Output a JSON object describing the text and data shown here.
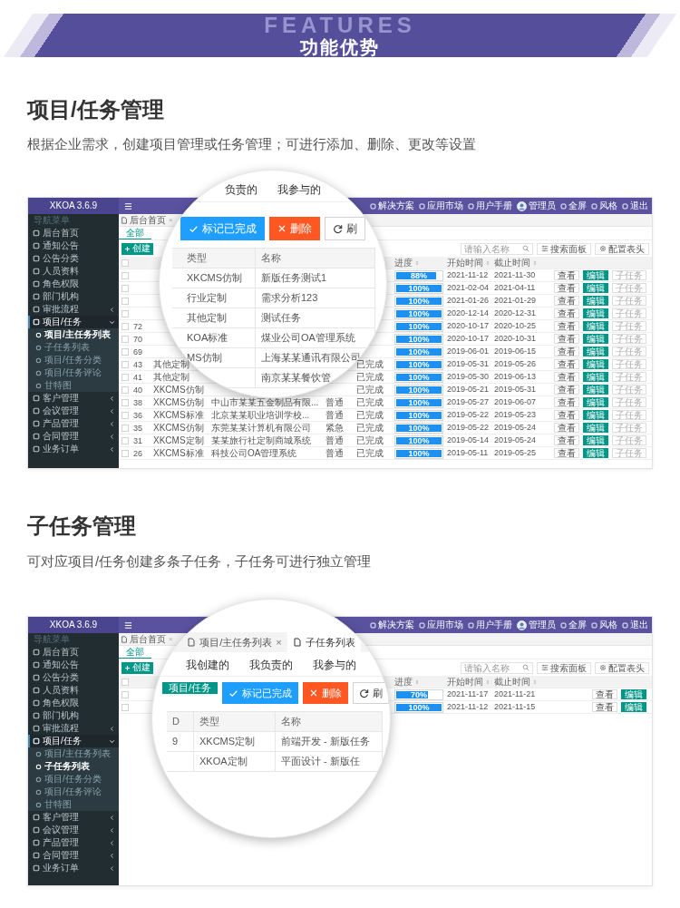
{
  "banner": {
    "backdrop_text": "FEATURES",
    "title": "功能优势"
  },
  "sections": [
    {
      "heading": "项目/任务管理",
      "description": "根据企业需求，创建项目管理或任务管理；可进行添加、删除、更改等设置",
      "screenshot": {
        "top_bar": {
          "logo": "XKOA 3.6.9",
          "items": [
            {
              "kind": "link",
              "label": "解决方案"
            },
            {
              "kind": "link",
              "label": "应用市场"
            },
            {
              "kind": "link",
              "label": "用户手册"
            },
            {
              "kind": "user",
              "label": "管理员"
            },
            {
              "kind": "link",
              "label": "全屏"
            },
            {
              "kind": "link",
              "label": "风格"
            },
            {
              "kind": "link",
              "label": "退出"
            }
          ]
        },
        "sidebar": {
          "header": "导航菜单",
          "items": [
            {
              "kind": "link",
              "label": "后台首页"
            },
            {
              "kind": "link",
              "label": "通知公告"
            },
            {
              "kind": "link",
              "label": "公告分类"
            },
            {
              "kind": "link",
              "label": "人员资料"
            },
            {
              "kind": "link",
              "label": "角色权限"
            },
            {
              "kind": "link",
              "label": "部门机构"
            },
            {
              "kind": "group",
              "label": "审批流程",
              "expanded": false
            },
            {
              "kind": "group",
              "label": "项目/任务",
              "expanded": true,
              "children": [
                {
                  "label": "项目/主任务列表",
                  "selected": true
                },
                {
                  "label": "子任务列表",
                  "selected": false
                },
                {
                  "label": "项目/任务分类",
                  "selected": false
                },
                {
                  "label": "项目/任务评论",
                  "selected": false
                },
                {
                  "label": "甘特图",
                  "selected": false
                }
              ]
            },
            {
              "kind": "group",
              "label": "客户管理",
              "expanded": false
            },
            {
              "kind": "group",
              "label": "会议管理",
              "expanded": false
            },
            {
              "kind": "group",
              "label": "产品管理",
              "expanded": false
            },
            {
              "kind": "group",
              "label": "合同管理",
              "expanded": false
            },
            {
              "kind": "group",
              "label": "业务订单",
              "expanded": false
            }
          ]
        },
        "page_tabs": [
          {
            "label": "后台首页",
            "close": "×"
          }
        ],
        "filter_tabs": [
          {
            "label": "全部",
            "selected": true
          }
        ],
        "create_button": {
          "label": "创建"
        },
        "search": {
          "placeholder": "请输入名称"
        },
        "tool_buttons": [
          {
            "kind": "panel",
            "label": "搜索面板"
          },
          {
            "kind": "settings",
            "label": "配置表头"
          }
        ],
        "table": {
          "all_checked": false,
          "headers": {
            "progress": "进度",
            "start": "开始时间",
            "end": "截止时间"
          },
          "rows": [
            {
              "checked": false,
              "progress": {
                "level": 0.88,
                "label": "88%"
              },
              "start": "2021-11-12",
              "end": "2021-11-30",
              "actions": [
                {
                  "kind": "view",
                  "label": "查看"
                },
                {
                  "kind": "edit",
                  "label": "编辑"
                },
                {
                  "kind": "subtask",
                  "label": "子任务"
                }
              ]
            },
            {
              "checked": false,
              "progress": {
                "level": 1,
                "label": "100%"
              },
              "start": "2021-02-04",
              "end": "2021-04-11",
              "actions": [
                {
                  "kind": "view",
                  "label": "查看"
                },
                {
                  "kind": "edit",
                  "label": "编辑"
                },
                {
                  "kind": "subtask",
                  "label": "子任务"
                }
              ]
            },
            {
              "checked": false,
              "progress": {
                "level": 1,
                "label": "100%"
              },
              "start": "2021-01-26",
              "end": "2021-01-29",
              "actions": [
                {
                  "kind": "view",
                  "label": "查看"
                },
                {
                  "kind": "edit",
                  "label": "编辑"
                },
                {
                  "kind": "subtask",
                  "label": "子任务"
                }
              ]
            },
            {
              "checked": false,
              "progress": {
                "level": 1,
                "label": "100%"
              },
              "start": "2020-12-14",
              "end": "2020-12-31",
              "actions": [
                {
                  "kind": "view",
                  "label": "查看"
                },
                {
                  "kind": "edit",
                  "label": "编辑"
                },
                {
                  "kind": "subtask",
                  "label": "子任务"
                }
              ]
            },
            {
              "checked": false,
              "id": "72",
              "progress": {
                "level": 1,
                "label": "100%"
              },
              "start": "2020-10-17",
              "end": "2020-10-25",
              "actions": [
                {
                  "kind": "view",
                  "label": "查看"
                },
                {
                  "kind": "edit",
                  "label": "编辑"
                },
                {
                  "kind": "subtask",
                  "label": "子任务"
                }
              ]
            },
            {
              "checked": false,
              "id": "70",
              "progress": {
                "level": 1,
                "label": "100%"
              },
              "start": "2020-10-17",
              "end": "2020-10-31",
              "actions": [
                {
                  "kind": "view",
                  "label": "查看"
                },
                {
                  "kind": "edit",
                  "label": "编辑"
                },
                {
                  "kind": "subtask",
                  "label": "子任务"
                }
              ]
            },
            {
              "checked": false,
              "id": "69",
              "progress": {
                "level": 1,
                "label": "100%"
              },
              "start": "2019-06-01",
              "end": "2019-06-15",
              "actions": [
                {
                  "kind": "view",
                  "label": "查看"
                },
                {
                  "kind": "edit",
                  "label": "编辑"
                },
                {
                  "kind": "subtask",
                  "label": "子任务"
                }
              ]
            },
            {
              "checked": false,
              "id": "43",
              "type": "其他定制",
              "status": "已完成",
              "progress": {
                "level": 1,
                "label": "100%"
              },
              "start": "2019-05-31",
              "end": "2019-05-26",
              "actions": [
                {
                  "kind": "view",
                  "label": "查看"
                },
                {
                  "kind": "edit",
                  "label": "编辑"
                },
                {
                  "kind": "subtask",
                  "label": "子任务"
                }
              ]
            },
            {
              "checked": false,
              "id": "41",
              "type": "其他定制",
              "status": "已完成",
              "progress": {
                "level": 1,
                "label": "100%"
              },
              "start": "2019-05-30",
              "end": "2019-06-13",
              "actions": [
                {
                  "kind": "view",
                  "label": "查看"
                },
                {
                  "kind": "edit",
                  "label": "编辑"
                },
                {
                  "kind": "subtask",
                  "label": "子任务"
                }
              ]
            },
            {
              "checked": false,
              "id": "40",
              "type": "XKCMS仿制",
              "status": "已完成",
              "progress": {
                "level": 1,
                "label": "100%"
              },
              "start": "2019-05-21",
              "end": "2019-05-31",
              "actions": [
                {
                  "kind": "view",
                  "label": "查看"
                },
                {
                  "kind": "edit",
                  "label": "编辑"
                },
                {
                  "kind": "subtask",
                  "label": "子任务"
                }
              ]
            },
            {
              "checked": false,
              "id": "38",
              "type": "XKCMS仿制",
              "name": "中山市某某五金制品有限...",
              "level": "普通",
              "status": "已完成",
              "progress": {
                "level": 1,
                "label": "100%"
              },
              "start": "2019-05-27",
              "end": "2019-06-07",
              "actions": [
                {
                  "kind": "view",
                  "label": "查看"
                },
                {
                  "kind": "edit",
                  "label": "编辑"
                },
                {
                  "kind": "subtask",
                  "label": "子任务"
                }
              ]
            },
            {
              "checked": false,
              "id": "36",
              "type": "XKCMS标准",
              "name": "北京某某职业培训学校...",
              "level": "普通",
              "status": "已完成",
              "progress": {
                "level": 1,
                "label": "100%"
              },
              "start": "2019-05-22",
              "end": "2019-05-23",
              "actions": [
                {
                  "kind": "view",
                  "label": "查看"
                },
                {
                  "kind": "edit",
                  "label": "编辑"
                },
                {
                  "kind": "subtask",
                  "label": "子任务"
                }
              ]
            },
            {
              "checked": false,
              "id": "35",
              "type": "XKCMS仿制",
              "name": "东莞某某计算机有限公司",
              "level": "紧急",
              "status": "已完成",
              "progress": {
                "level": 1,
                "label": "100%"
              },
              "start": "2019-05-22",
              "end": "2019-05-24",
              "actions": [
                {
                  "kind": "view",
                  "label": "查看"
                },
                {
                  "kind": "edit",
                  "label": "编辑"
                },
                {
                  "kind": "subtask",
                  "label": "子任务"
                }
              ]
            },
            {
              "checked": false,
              "id": "31",
              "type": "XKCMS定制",
              "name": "某某旅行社定制商城系统",
              "level": "普通",
              "status": "已完成",
              "progress": {
                "level": 1,
                "label": "100%"
              },
              "start": "2019-05-14",
              "end": "2019-05-24",
              "actions": [
                {
                  "kind": "view",
                  "label": "查看"
                },
                {
                  "kind": "edit",
                  "label": "编辑"
                },
                {
                  "kind": "subtask",
                  "label": "子任务"
                }
              ]
            },
            {
              "checked": false,
              "id": "26",
              "type": "XKCMS标准",
              "name": "科技公司OA管理系统",
              "level": "普通",
              "status": "已完成",
              "progress": {
                "level": 1,
                "label": "100%"
              },
              "start": "2019-05-11",
              "end": "2019-05-25",
              "actions": [
                {
                  "kind": "view",
                  "label": "查看"
                },
                {
                  "kind": "edit",
                  "label": "编辑"
                },
                {
                  "kind": "subtask",
                  "label": "子任务"
                }
              ]
            }
          ]
        },
        "magnifier": {
          "tabs": [
            {
              "label": "负责的",
              "selected": false
            },
            {
              "label": "我参与的",
              "selected": false
            }
          ],
          "buttons": [
            {
              "kind": "complete",
              "label": "标记已完成"
            },
            {
              "kind": "delete",
              "label": "删除"
            },
            {
              "kind": "refresh",
              "label": "刷"
            }
          ],
          "columns": [
            {
              "kind": "type",
              "label": "类型"
            },
            {
              "kind": "name",
              "label": "名称"
            }
          ],
          "rows": [
            {
              "type": "XKCMS仿制",
              "name": "新版任务测试1"
            },
            {
              "type": "行业定制",
              "name": "需求分析123"
            },
            {
              "type": "其他定制",
              "name": "测试任务"
            },
            {
              "type": "KOA标准",
              "name": "煤业公司OA管理系统"
            },
            {
              "type": "MS仿制",
              "name": "上海某某通讯有限公司"
            },
            {
              "name": "南京某某餐饮管"
            }
          ]
        }
      }
    },
    {
      "heading": "子任务管理",
      "description": "可对应项目/任务创建多条子任务，子任务可进行独立管理",
      "screenshot": {
        "top_bar": {
          "logo": "XKOA 3.6.9",
          "items": [
            {
              "kind": "link",
              "label": "解决方案"
            },
            {
              "kind": "link",
              "label": "应用市场"
            },
            {
              "kind": "link",
              "label": "用户手册"
            },
            {
              "kind": "user",
              "label": "管理员"
            },
            {
              "kind": "link",
              "label": "全屏"
            },
            {
              "kind": "link",
              "label": "风格"
            },
            {
              "kind": "link",
              "label": "退出"
            }
          ]
        },
        "sidebar": {
          "header": "导航菜单",
          "items": [
            {
              "kind": "link",
              "label": "后台首页"
            },
            {
              "kind": "link",
              "label": "通知公告"
            },
            {
              "kind": "link",
              "label": "公告分类"
            },
            {
              "kind": "link",
              "label": "人员资料"
            },
            {
              "kind": "link",
              "label": "角色权限"
            },
            {
              "kind": "link",
              "label": "部门机构"
            },
            {
              "kind": "group",
              "label": "审批流程",
              "expanded": false
            },
            {
              "kind": "group",
              "label": "项目/任务",
              "expanded": true,
              "children": [
                {
                  "label": "项目/主任务列表",
                  "selected": false
                },
                {
                  "label": "子任务列表",
                  "selected": true
                },
                {
                  "label": "项目/任务分类",
                  "selected": false
                },
                {
                  "label": "项目/任务评论",
                  "selected": false
                },
                {
                  "label": "甘特图",
                  "selected": false
                }
              ]
            },
            {
              "kind": "group",
              "label": "客户管理",
              "expanded": false
            },
            {
              "kind": "group",
              "label": "会议管理",
              "expanded": false
            },
            {
              "kind": "group",
              "label": "产品管理",
              "expanded": false
            },
            {
              "kind": "group",
              "label": "合同管理",
              "expanded": false
            },
            {
              "kind": "group",
              "label": "业务订单",
              "expanded": false
            }
          ]
        },
        "page_tabs": [
          {
            "label": "后台首页",
            "close": "×"
          }
        ],
        "filter_tabs": [
          {
            "label": "全部",
            "selected": true
          }
        ],
        "create_button": {
          "label": "创建"
        },
        "search": {
          "placeholder": "请输入名称"
        },
        "tool_buttons": [
          {
            "kind": "panel",
            "label": "搜索面板"
          },
          {
            "kind": "settings",
            "label": "配置表头"
          }
        ],
        "table": {
          "all_checked": false,
          "headers": {
            "progress": "进度",
            "start": "开始时间",
            "end": "截止时间"
          },
          "rows": [
            {
              "checked": false,
              "progress": {
                "level": 0.7,
                "label": "70%"
              },
              "start": "2021-11-17",
              "end": "2021-11-21",
              "actions": [
                {
                  "kind": "view",
                  "label": "查看"
                },
                {
                  "kind": "edit",
                  "label": "编辑"
                }
              ]
            },
            {
              "checked": false,
              "progress": {
                "level": 1,
                "label": "100%"
              },
              "start": "2021-11-12",
              "end": "2021-11-15",
              "actions": [
                {
                  "kind": "view",
                  "label": "查看"
                },
                {
                  "kind": "edit",
                  "label": "编辑"
                }
              ]
            }
          ]
        },
        "magnifier": {
          "page_tabs": [
            {
              "label": "项目/主任务列表",
              "close": "×",
              "selected": false
            },
            {
              "label": "子任务列表",
              "selected": true
            }
          ],
          "tabs": [
            {
              "label": "我创建的",
              "selected": false
            },
            {
              "label": "我负责的",
              "selected": false
            },
            {
              "label": "我参与的",
              "selected": false
            }
          ],
          "buttons": [
            {
              "kind": "create",
              "label": "项目/任务"
            },
            {
              "kind": "complete",
              "label": "标记已完成"
            },
            {
              "kind": "delete",
              "label": "删除"
            },
            {
              "kind": "refresh",
              "label": "刷"
            }
          ],
          "columns": [
            {
              "kind": "id",
              "label": "D"
            },
            {
              "kind": "type",
              "label": "类型"
            },
            {
              "kind": "name",
              "label": "名称"
            }
          ],
          "rows": [
            {
              "id": "9",
              "type": "XKCMS定制",
              "name": "前端开发 - 新版任务"
            },
            {
              "type": "XKOA定制",
              "name": "平面设计 - 新版任"
            }
          ]
        }
      }
    }
  ]
}
